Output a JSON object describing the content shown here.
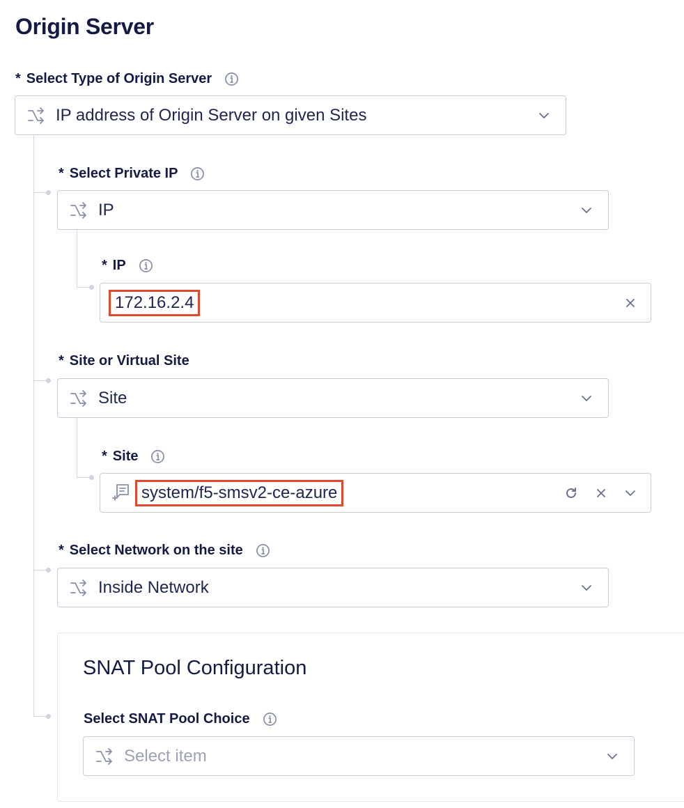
{
  "section_title": "Origin Server",
  "origin_type": {
    "label": "Select Type of Origin Server",
    "required": "*",
    "value": "IP address of Origin Server on given Sites"
  },
  "private_ip": {
    "label": "Select Private IP",
    "required": "*",
    "value": "IP"
  },
  "ip": {
    "label": "IP",
    "required": "*",
    "value": "172.16.2.4"
  },
  "site_or_virtual": {
    "label": "Site or Virtual Site",
    "required": "*",
    "value": "Site"
  },
  "site": {
    "label": "Site",
    "required": "*",
    "value": "system/f5-smsv2-ce-azure"
  },
  "network": {
    "label": "Select Network on the site",
    "required": "*",
    "value": "Inside Network"
  },
  "snat": {
    "panel_title": "SNAT Pool Configuration",
    "label": "Select SNAT Pool Choice",
    "placeholder": "Select item"
  },
  "colors": {
    "highlight": "#e04a2e",
    "text": "#151a45",
    "border": "#c9ccd6"
  }
}
